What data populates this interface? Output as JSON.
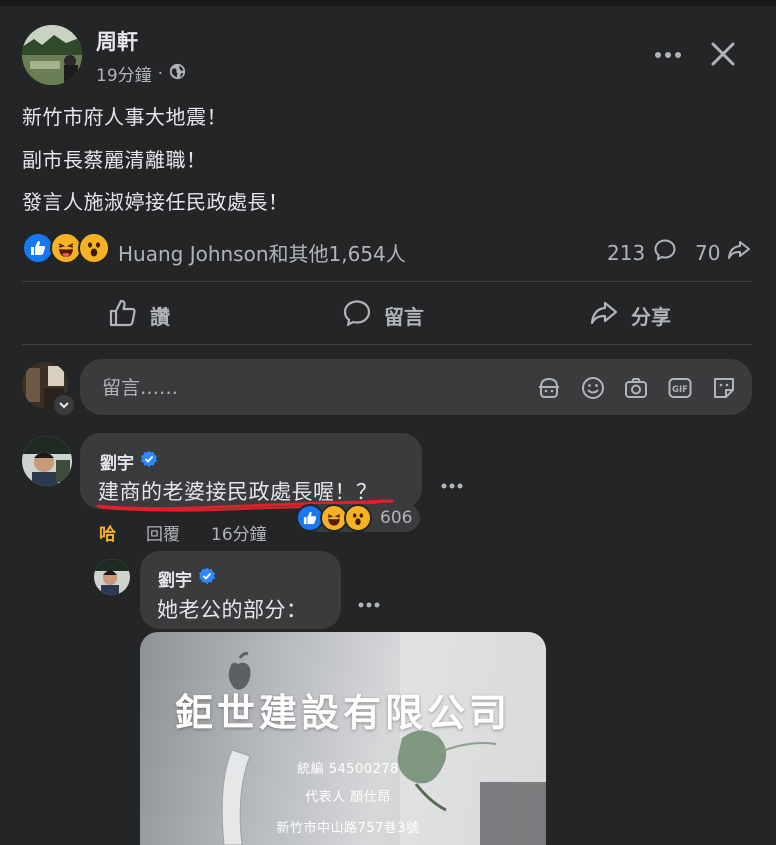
{
  "post": {
    "author": "周軒",
    "time": "19分鐘",
    "separator": "·",
    "lines": [
      "新竹市府人事大地震！",
      "副市長蔡麗清離職！",
      "發言人施淑婷接任民政處長！"
    ],
    "reactions_text": "Huang Johnson和其他1,654人",
    "comments_count": "213",
    "shares_count": "70"
  },
  "actions": {
    "like": "讚",
    "comment": "留言",
    "share": "分享"
  },
  "composer": {
    "placeholder": "留言……"
  },
  "comment": {
    "author": "劉宇",
    "text": "建商的老婆接民政處長喔！？",
    "reaction_label": "哈",
    "reply_label": "回覆",
    "time": "16分鐘",
    "reaction_count": "606"
  },
  "reply": {
    "author": "劉宇",
    "text": "她老公的部分："
  },
  "card": {
    "title": "鉅世建設有限公司",
    "tax_id": "統編 54500278",
    "representative": "代表人 顏仕昂",
    "address": "新竹市中山路757巷3號"
  },
  "colors": {
    "background": "#242526",
    "bubble": "#3a3b3c",
    "text": "#e4e6eb",
    "secondary": "#b0b3b8",
    "like_blue": "#1877f2",
    "haha_orange": "#f7b125",
    "verified": "#2d88ff",
    "annotation_red": "#e0202a"
  },
  "icons": [
    "globe-icon",
    "more-icon",
    "close-icon",
    "like-reaction-icon",
    "haha-reaction-icon",
    "wow-reaction-icon",
    "comment-icon",
    "share-icon",
    "avatar-frame-icon",
    "emoji-icon",
    "camera-icon",
    "gif-icon",
    "sticker-icon",
    "verified-badge-icon"
  ]
}
